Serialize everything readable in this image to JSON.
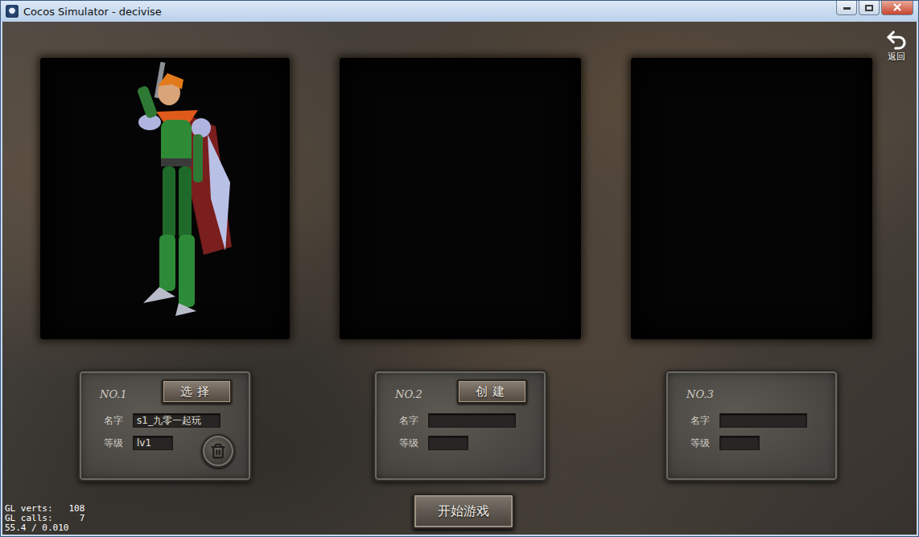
{
  "window": {
    "title": "Cocos Simulator - decivise"
  },
  "back_button": {
    "label": "返回"
  },
  "slots": [
    {
      "number": "NO.1",
      "action": "选择",
      "name_label": "名字",
      "name": "s1_九零一起玩",
      "level_label": "等级",
      "level": "lv1",
      "occupied": true
    },
    {
      "number": "NO.2",
      "action": "创建",
      "name_label": "名字",
      "name": "",
      "level_label": "等级",
      "level": "",
      "occupied": false
    },
    {
      "number": "NO.3",
      "action": "",
      "name_label": "名字",
      "name": "",
      "level_label": "等级",
      "level": "",
      "occupied": false
    }
  ],
  "start_button": {
    "label": "开始游戏"
  },
  "debug_stats": [
    "GL verts:   108",
    "GL calls:     7",
    "55.4 / 0.010"
  ]
}
